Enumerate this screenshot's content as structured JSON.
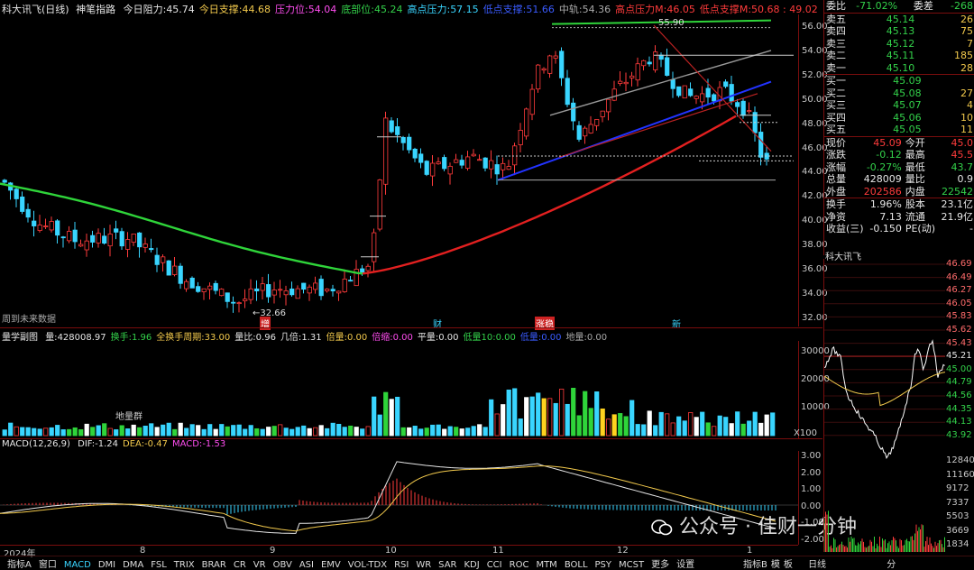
{
  "header": {
    "title": "科大讯飞(日线)",
    "indicator": "神笔指路",
    "items": [
      {
        "label": "今日阻力:",
        "value": "45.74",
        "color": "#e6e6e6"
      },
      {
        "label": "今日支撑:",
        "value": "44.68",
        "color": "#f2c94c"
      },
      {
        "label": "压力位:",
        "value": "54.04",
        "color": "#ff4df0"
      },
      {
        "label": "底部位:",
        "value": "45.24",
        "color": "#33d14a"
      },
      {
        "label": "高点压力:",
        "value": "57.15",
        "color": "#39d5ff"
      },
      {
        "label": "低点支撑:",
        "value": "51.66",
        "color": "#3a5bff"
      },
      {
        "label": "中轨:",
        "value": "54.36",
        "color": "#aaaaaa"
      },
      {
        "label": "高点压力M:",
        "value": "46.05",
        "color": "#ff3b3b"
      },
      {
        "label": "低点支撑M:",
        "value": "50.68 : 49.02",
        "color": "#ff3b3b"
      }
    ]
  },
  "price_axis": [
    "56.00",
    "54.00",
    "52.00",
    "50.00",
    "48.00",
    "46.00",
    "44.00",
    "42.00",
    "40.00",
    "38.00",
    "36.00",
    "34.00",
    "32.00"
  ],
  "annotations": {
    "high": "55.90",
    "low": "←32.66",
    "future": "周到未来数据",
    "markers": [
      "增",
      "财",
      "涨稳",
      "新"
    ]
  },
  "volume_header": {
    "label": "量学副图",
    "items": [
      {
        "label": "量:",
        "value": "428008.97",
        "color": "#e6e6e6"
      },
      {
        "label": "换手:",
        "value": "1.96",
        "color": "#33d14a"
      },
      {
        "label": "全换手周期:",
        "value": "33.00",
        "color": "#f2c94c"
      },
      {
        "label": "量比:",
        "value": "0.96",
        "color": "#e6e6e6"
      },
      {
        "label": "几倍:",
        "value": "1.31",
        "color": "#e6e6e6"
      },
      {
        "label": "倍量:",
        "value": "0.00",
        "color": "#f2c94c"
      },
      {
        "label": "倍缩:",
        "value": "0.00",
        "color": "#ff4df0"
      },
      {
        "label": "平量:",
        "value": "0.00",
        "color": "#e6e6e6"
      },
      {
        "label": "低量10:",
        "value": "0.00",
        "color": "#33d14a"
      },
      {
        "label": "低量:",
        "value": "0.00",
        "color": "#3a5bff"
      },
      {
        "label": "地量:",
        "value": "0.00",
        "color": "#aaaaaa"
      }
    ],
    "note": "地量群",
    "axis": [
      "30000",
      "20000",
      "10000"
    ],
    "unit": "X100"
  },
  "macd_header": {
    "label": "MACD(12,26,9)",
    "items": [
      {
        "label": "DIF:",
        "value": "-1.24",
        "color": "#e6e6e6"
      },
      {
        "label": "DEA:",
        "value": "-0.47",
        "color": "#f2c94c"
      },
      {
        "label": "MACD:",
        "value": "-1.53",
        "color": "#ff4df0"
      }
    ],
    "axis": [
      "3.00",
      "2.00",
      "1.00",
      "0.00",
      "-1.00",
      "-2.00"
    ]
  },
  "x_axis": [
    "2024年",
    "8",
    "9",
    "10",
    "11",
    "12",
    "1"
  ],
  "quote": {
    "webi": {
      "label": "委比",
      "value": "-71.02%",
      "label2": "委差",
      "value2": "-268"
    },
    "asks": [
      {
        "label": "卖五",
        "price": "45.14",
        "vol": "26"
      },
      {
        "label": "卖四",
        "price": "45.13",
        "vol": "75"
      },
      {
        "label": "卖三",
        "price": "45.12",
        "vol": "7"
      },
      {
        "label": "卖二",
        "price": "45.11",
        "vol": "185"
      },
      {
        "label": "卖一",
        "price": "45.10",
        "vol": "28"
      }
    ],
    "bids": [
      {
        "label": "买一",
        "price": "45.09",
        "vol": ""
      },
      {
        "label": "买二",
        "price": "45.08",
        "vol": "27"
      },
      {
        "label": "买三",
        "price": "45.07",
        "vol": "4"
      },
      {
        "label": "买四",
        "price": "45.06",
        "vol": "10"
      },
      {
        "label": "买五",
        "price": "45.05",
        "vol": "11"
      }
    ],
    "stats": [
      {
        "l1": "现价",
        "v1": "45.09",
        "c1": "#ff3b3b",
        "l2": "今开",
        "v2": "45.0",
        "c2": "#ff3b3b"
      },
      {
        "l1": "涨跌",
        "v1": "-0.12",
        "c1": "#33d14a",
        "l2": "最高",
        "v2": "45.5",
        "c2": "#ff3b3b"
      },
      {
        "l1": "涨幅",
        "v1": "-0.27%",
        "c1": "#33d14a",
        "l2": "最低",
        "v2": "43.7",
        "c2": "#33d14a"
      },
      {
        "l1": "总量",
        "v1": "428009",
        "c1": "#e6e6e6",
        "l2": "量比",
        "v2": "0.9",
        "c2": "#e6e6e6"
      },
      {
        "l1": "外盘",
        "v1": "202586",
        "c1": "#ff3b3b",
        "l2": "内盘",
        "v2": "22542",
        "c2": "#33d14a"
      }
    ],
    "stats2": [
      {
        "l1": "换手",
        "v1": "1.96%",
        "l2": "股本",
        "v2": "23.1亿"
      },
      {
        "l1": "净资",
        "v1": "7.13",
        "l2": "流通",
        "v2": "21.9亿"
      },
      {
        "l1": "收益(三)",
        "v1": "-0.150",
        "l2": "PE(动)",
        "v2": "-"
      }
    ]
  },
  "intraday": {
    "title": "科大讯飞",
    "axis": [
      "46.69",
      "46.49",
      "46.27",
      "46.05",
      "45.83",
      "45.62",
      "45.43",
      "45.21",
      "45.00",
      "44.79",
      "44.56",
      "44.35",
      "44.13",
      "43.92"
    ],
    "vol_axis": [
      "12840",
      "11160",
      "9172",
      "7337",
      "5503",
      "3669",
      "1834"
    ]
  },
  "toolbar": {
    "tabs": [
      "指标A",
      "窗口",
      "MACD",
      "DMI",
      "DMA",
      "FSL",
      "TRIX",
      "BRAR",
      "CR",
      "VR",
      "OBV",
      "ASI",
      "EMV",
      "VOL-TDX",
      "RSI",
      "WR",
      "SAR",
      "KDJ",
      "CCI",
      "ROC",
      "MTM",
      "BOLL",
      "PSY",
      "MCST",
      "更多",
      "设置"
    ],
    "active": "MACD",
    "right": [
      "指标B",
      "模",
      "板"
    ],
    "right_tab": "日线",
    "right_tab2": "分"
  },
  "watermark": "公众号 · 佳财一分钟"
}
